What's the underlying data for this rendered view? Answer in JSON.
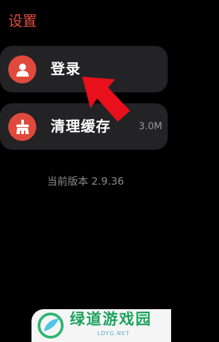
{
  "header": {
    "title": "设置"
  },
  "items": [
    {
      "label": "登录",
      "icon": "user-icon",
      "value": ""
    },
    {
      "label": "清理缓存",
      "icon": "broom-icon",
      "value": "3.0M"
    }
  ],
  "footer": {
    "version_text": "当前版本 2.9.36"
  },
  "watermark": {
    "text": "绿道游戏园",
    "sub": "LDYG.NET"
  },
  "colors": {
    "accent": "#e04a3c",
    "background": "#000000",
    "card": "#232325",
    "arrow": "#e8101a",
    "watermark_green": "#1aa35c"
  }
}
